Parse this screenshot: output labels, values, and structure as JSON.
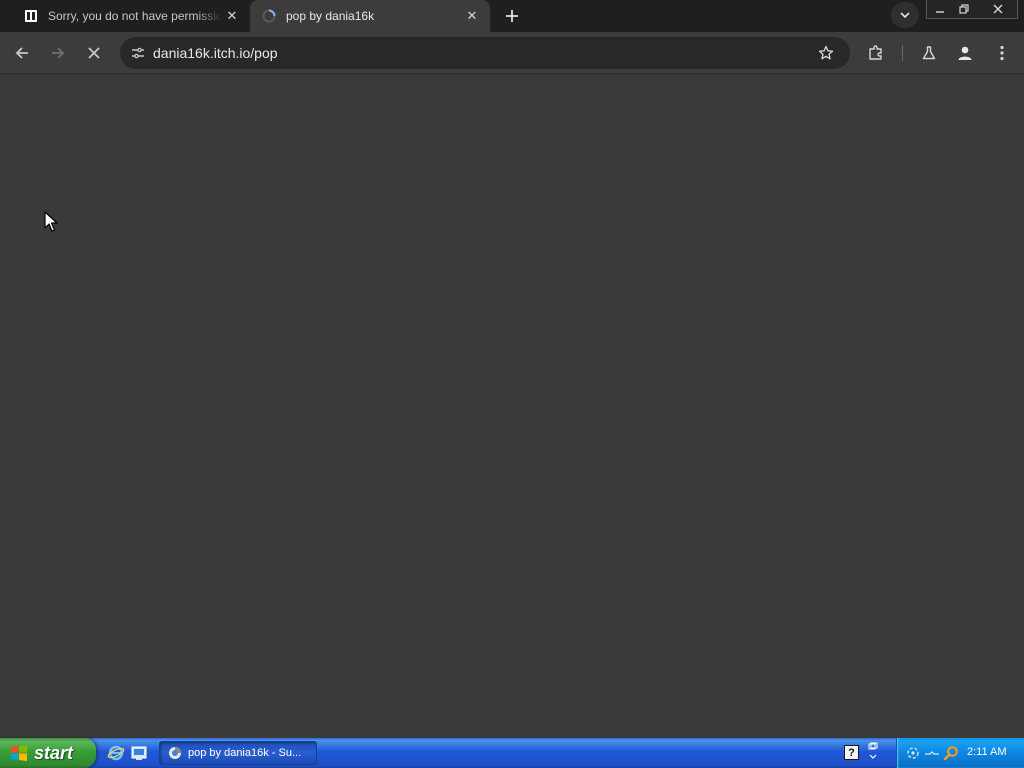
{
  "browser": {
    "tabs": [
      {
        "title": "Sorry, you do not have permission",
        "favicon": "itch-io-icon",
        "active": false
      },
      {
        "title": "pop by dania16k",
        "favicon": "loading-spinner-icon",
        "active": true
      }
    ],
    "address": {
      "url": "dania16k.itch.io/pop"
    },
    "loading": true
  },
  "taskbar": {
    "start_label": "start",
    "task_button_label": "pop by dania16k - Su...",
    "help_glyph": "?",
    "clock": "2:11 AM"
  },
  "colors": {
    "content_bg": "#3a3a3a",
    "tabstrip_bg": "#1f1f1f",
    "toolbar_bg": "#3c3c3c",
    "taskbar_blue": "#245edb",
    "start_green": "#3a9a3a"
  }
}
